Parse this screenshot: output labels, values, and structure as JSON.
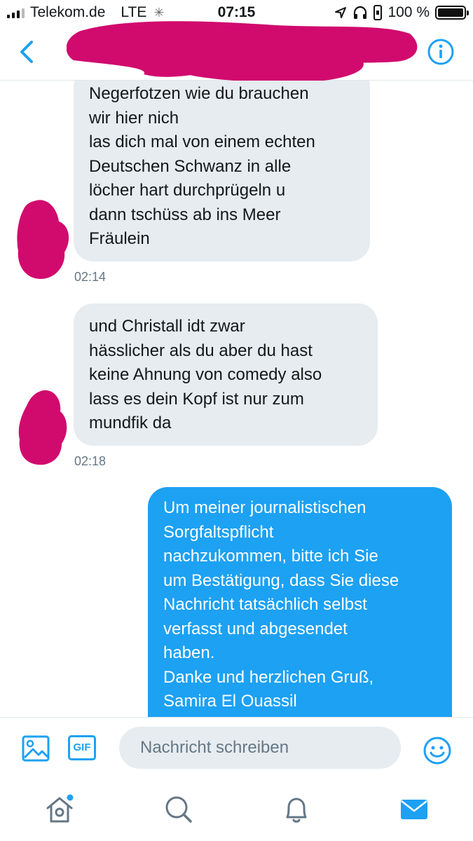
{
  "status_bar": {
    "carrier": "Telekom.de",
    "network": "LTE",
    "time": "07:15",
    "battery": "100 %"
  },
  "colors": {
    "accent": "#1da1f2",
    "incoming_bubble": "#e6ecf0",
    "redaction": "#d10a6e",
    "timestamp": "#657786"
  },
  "messages": [
    {
      "direction": "incoming",
      "lines": [
        "Negerfotzen wie du brauchen",
        "wir hier nich",
        "las dich mal von einem echten",
        "Deutschen Schwanz in alle",
        "löcher hart durchprügeln u",
        "dann tschüss ab ins Meer",
        "Fräulein"
      ],
      "time": "02:14"
    },
    {
      "direction": "incoming",
      "lines": [
        "und Christall idt zwar",
        "hässlicher als du aber du hast",
        "keine Ahnung von comedy also",
        "lass es dein Kopf ist nur zum",
        "mundfik da"
      ],
      "time": "02:18"
    },
    {
      "direction": "outgoing",
      "lines": [
        "Um meiner journalistischen",
        "Sorgfaltspflicht",
        "nachzukommen, bitte ich Sie",
        "um Bestätigung, dass Sie diese",
        "Nachricht tatsächlich selbst",
        "verfasst und abgesendet",
        "haben.",
        "Danke und herzlichen Gruß,",
        "Samira El Ouassil"
      ]
    }
  ],
  "compose": {
    "placeholder": "Nachricht schreiben",
    "gif_label": "GIF"
  },
  "icons": {
    "back": "chevron-left-icon",
    "info": "info-icon",
    "image": "image-icon",
    "gif": "gif-icon",
    "emoji": "emoji-icon",
    "home": "home-icon",
    "search": "search-icon",
    "notifications": "bell-icon",
    "messages": "mail-icon"
  }
}
